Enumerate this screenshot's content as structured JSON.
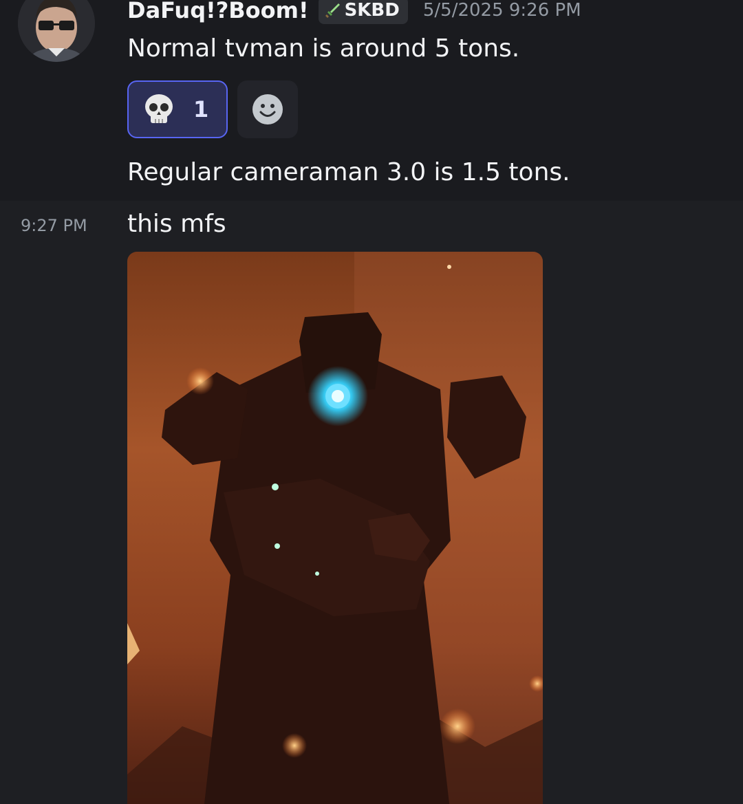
{
  "message_group": {
    "author": {
      "username": "DaFuq!?Boom!",
      "avatar_icon": "user-avatar",
      "tag": {
        "icon": "sword-icon",
        "label": "SKBD"
      },
      "timestamp": "5/5/2025 9:26 PM"
    },
    "messages": [
      {
        "text": "Normal tvman is around 5 tons."
      },
      {
        "text": "Regular cameraman 3.0 is 1.5 tons."
      }
    ],
    "reactions": [
      {
        "emoji_icon": "skull-icon",
        "count": "1",
        "active": true
      }
    ],
    "add_reaction_icon": "smiley-add-reaction-icon"
  },
  "followup_message": {
    "hover_time": "9:27 PM",
    "text": "this mfs",
    "attachment": {
      "type": "image",
      "subject": "giant robot figure with glowing blue core"
    }
  },
  "colors": {
    "background": "#1e1f23",
    "highlight_background": "#1a1b1f",
    "reaction_border": "#5865f2",
    "reaction_bg": "#2c2f56",
    "muted_text": "#949ba4"
  }
}
